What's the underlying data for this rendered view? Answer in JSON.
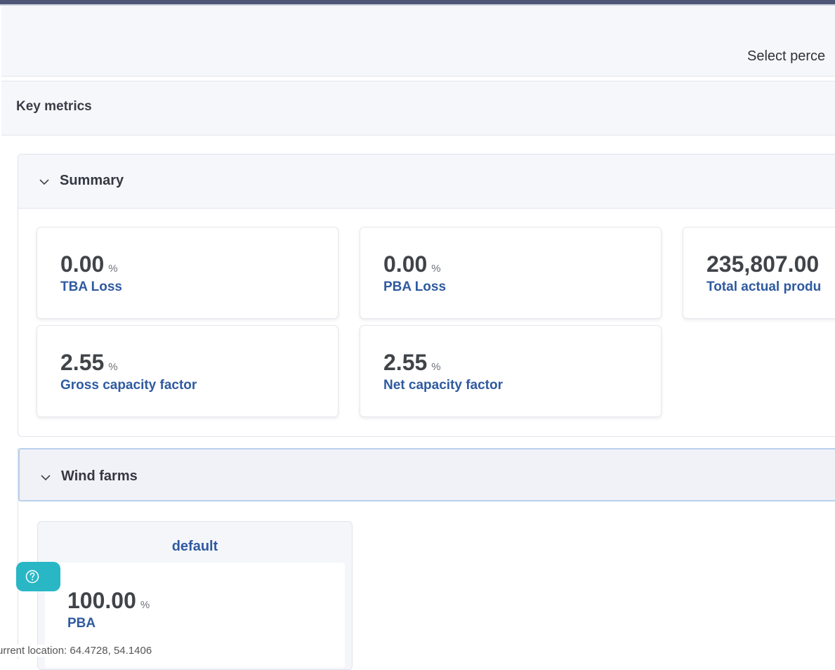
{
  "header": {
    "select_label": "Select perce"
  },
  "key_metrics": {
    "title": "Key metrics"
  },
  "summary": {
    "title": "Summary",
    "cards": [
      {
        "value": "0.00",
        "unit": "%",
        "label": "TBA Loss"
      },
      {
        "value": "0.00",
        "unit": "%",
        "label": "PBA Loss"
      },
      {
        "value": "235,807.00",
        "unit": "",
        "label": "Total actual produ"
      },
      {
        "value": "2.55",
        "unit": "%",
        "label": "Gross capacity factor"
      },
      {
        "value": "2.55",
        "unit": "%",
        "label": "Net capacity factor"
      }
    ]
  },
  "wind_farms": {
    "title": "Wind farms",
    "farm": {
      "name": "default",
      "value": "100.00",
      "unit": "%",
      "label": "PBA"
    }
  },
  "status": {
    "text": "urrent location: 64.4728, 54.1406"
  },
  "icons": {
    "collapse": "chevron-down-icon",
    "help": "question-circle-icon"
  },
  "colors": {
    "accent": "#2f5aa0",
    "help": "#29b7c6",
    "topbar": "#4d5676"
  }
}
